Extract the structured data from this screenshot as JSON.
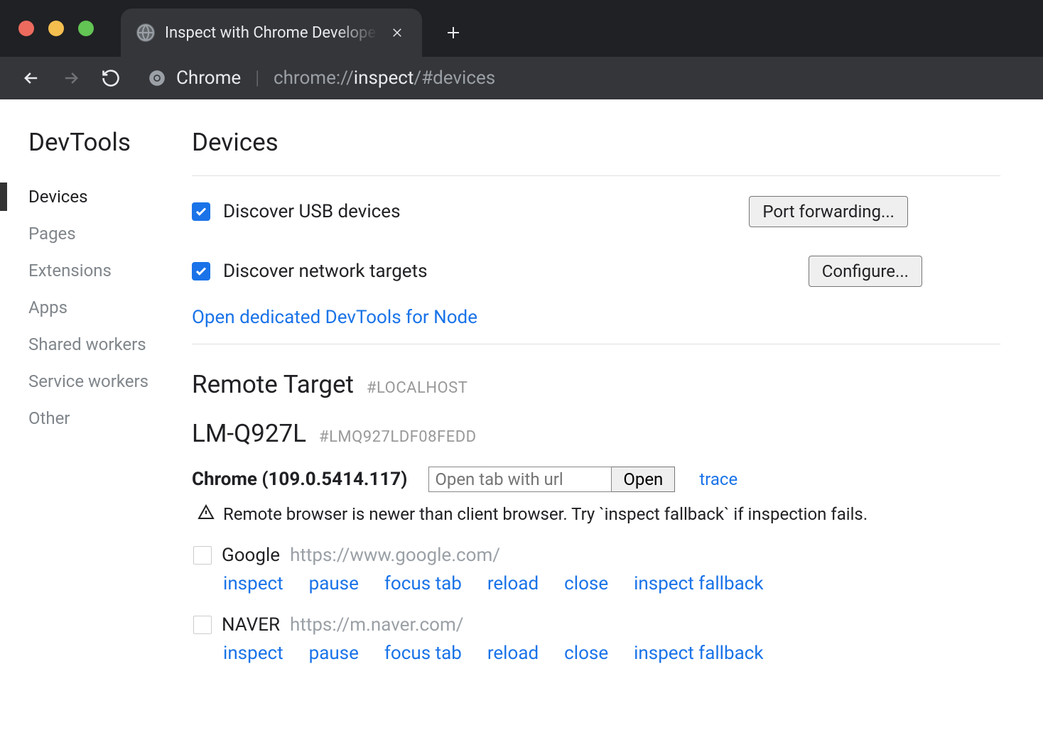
{
  "browser": {
    "tab_title": "Inspect with Chrome Developer",
    "omnibox": {
      "scheme_label": "Chrome",
      "proto": "chrome://",
      "host": "inspect",
      "path": "/#devices"
    }
  },
  "sidebar": {
    "title": "DevTools",
    "items": [
      {
        "label": "Devices",
        "active": true
      },
      {
        "label": "Pages",
        "active": false
      },
      {
        "label": "Extensions",
        "active": false
      },
      {
        "label": "Apps",
        "active": false
      },
      {
        "label": "Shared workers",
        "active": false
      },
      {
        "label": "Service workers",
        "active": false
      },
      {
        "label": "Other",
        "active": false
      }
    ]
  },
  "main": {
    "title": "Devices",
    "discover_usb_label": "Discover USB devices",
    "port_forwarding_label": "Port forwarding...",
    "discover_network_label": "Discover network targets",
    "configure_label": "Configure...",
    "node_link": "Open dedicated DevTools for Node",
    "remote_target_label": "Remote Target",
    "remote_target_sub": "#LOCALHOST",
    "device_name": "LM-Q927L",
    "device_id": "#LMQ927LDF08FEDD",
    "chrome_label": "Chrome (109.0.5414.117)",
    "open_tab_placeholder": "Open tab with url",
    "open_button": "Open",
    "trace_label": "trace",
    "warning_text": "Remote browser is newer than client browser. Try `inspect fallback` if inspection fails.",
    "actions": {
      "inspect": "inspect",
      "pause": "pause",
      "focus_tab": "focus tab",
      "reload": "reload",
      "close": "close",
      "inspect_fallback": "inspect fallback"
    },
    "targets": [
      {
        "title": "Google",
        "url": "https://www.google.com/"
      },
      {
        "title": "NAVER",
        "url": "https://m.naver.com/"
      }
    ]
  }
}
